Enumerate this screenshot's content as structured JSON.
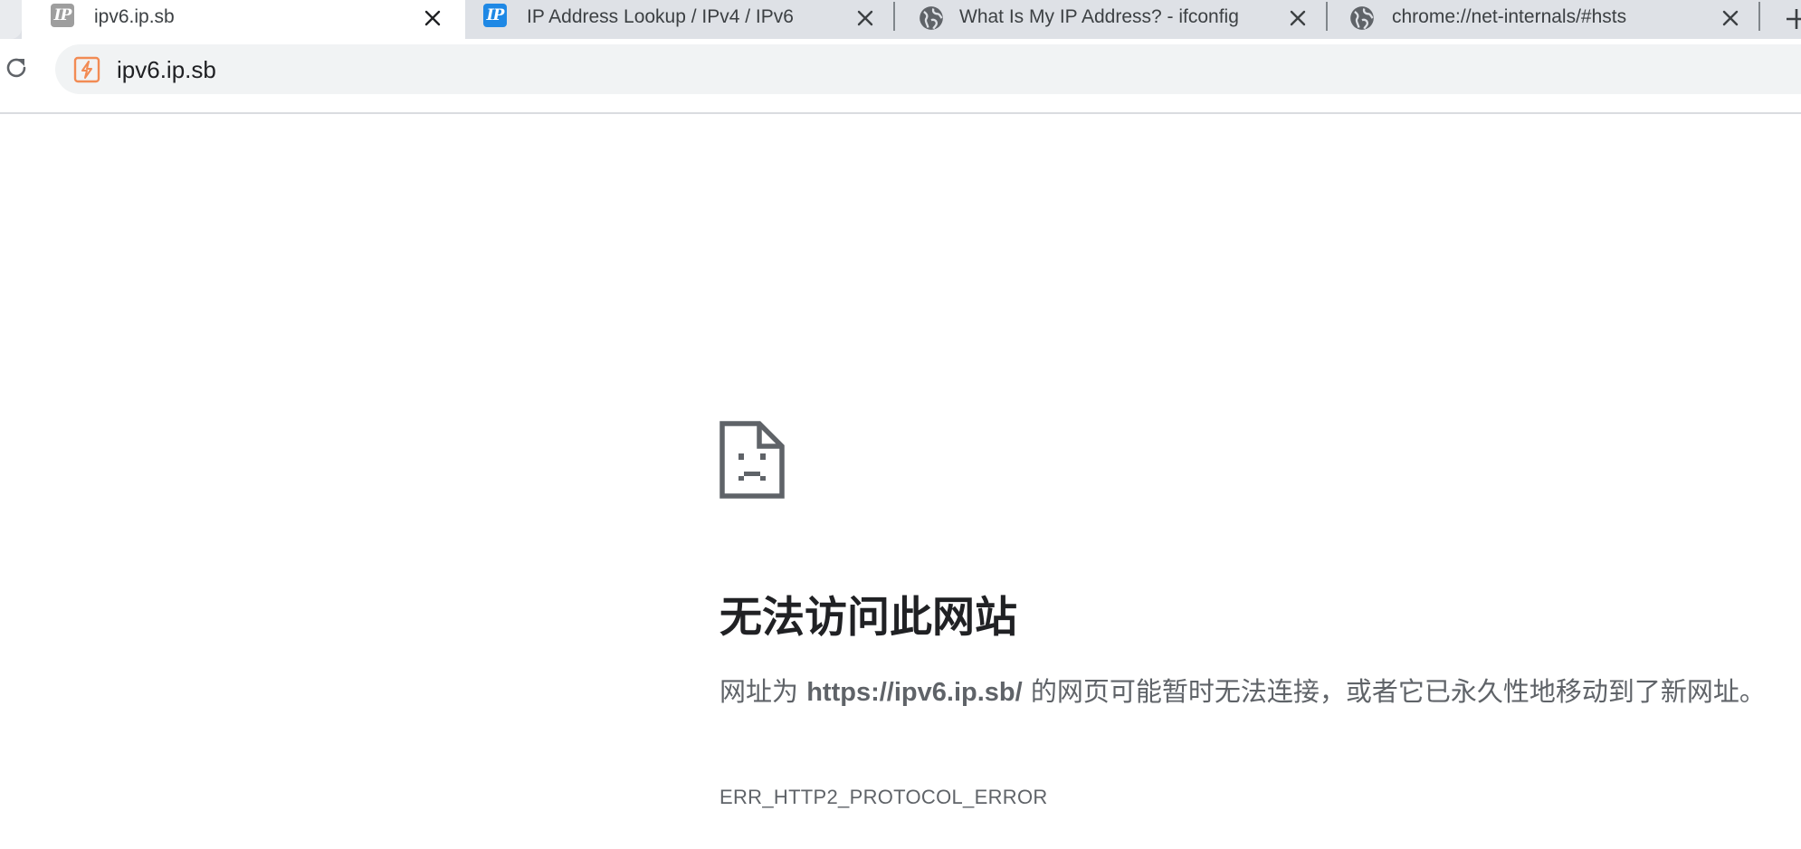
{
  "tabs": [
    {
      "title": "ipv6.ip.sb",
      "favicon": "ip-sb-logo-gray-icon",
      "active": true
    },
    {
      "title": "IP Address Lookup / IPv4 / IPv6",
      "favicon": "ip-sb-logo-blue-icon",
      "active": false
    },
    {
      "title": "What Is My IP Address? - ifconfig",
      "favicon": "globe-icon",
      "active": false
    },
    {
      "title": "chrome://net-internals/#hsts",
      "favicon": "globe-icon",
      "active": false
    }
  ],
  "favicon_text": "IP",
  "omnibox": {
    "url": "ipv6.ip.sb",
    "site_icon": "bolt-site-icon"
  },
  "error": {
    "icon": "sad-page-icon",
    "heading": "无法访问此网站",
    "desc_prefix": "网址为 ",
    "url": "https://ipv6.ip.sb/",
    "desc_suffix": " 的网页可能暂时无法连接，或者它已永久性地移动到了新网址。",
    "code": "ERR_HTTP2_PROTOCOL_ERROR"
  },
  "colors": {
    "tabstrip_bg": "#dee1e6",
    "active_tab_bg": "#ffffff",
    "omnibox_bg": "#f1f3f4",
    "favicon_blue": "#1e88e5",
    "site_icon_orange": "#f28b54",
    "text_secondary": "#5f6368"
  }
}
